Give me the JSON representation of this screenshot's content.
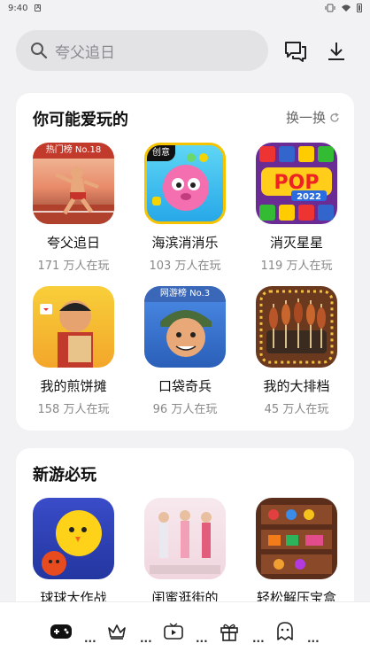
{
  "status_bar": {
    "time": "9:40"
  },
  "search": {
    "placeholder": "夸父追日"
  },
  "section_recommend": {
    "title": "你可能爱玩的",
    "refresh_label": "换一换",
    "games": [
      {
        "name": "夸父追日",
        "players": "171 万人在玩",
        "badge": "热门榜 No.18"
      },
      {
        "name": "海滨消消乐",
        "players": "103 万人在玩",
        "badge": "创意"
      },
      {
        "name": "消灭星星",
        "players": "119 万人在玩",
        "badge": ""
      },
      {
        "name": "我的煎饼摊",
        "players": "158 万人在玩",
        "badge": ""
      },
      {
        "name": "口袋奇兵",
        "players": "96 万人在玩",
        "badge": "网游榜 No.3"
      },
      {
        "name": "我的大排档",
        "players": "45 万人在玩",
        "badge": ""
      }
    ]
  },
  "section_new": {
    "title": "新游必玩",
    "games": [
      {
        "name": "球球大作战"
      },
      {
        "name": "闺蜜逛街的"
      },
      {
        "name": "轻松解压宝盒"
      }
    ]
  },
  "bottom_nav": {
    "dots": "..."
  },
  "colors": {
    "accent": "#111111",
    "card_bg": "#ffffff",
    "page_bg": "#f2f2f4"
  }
}
